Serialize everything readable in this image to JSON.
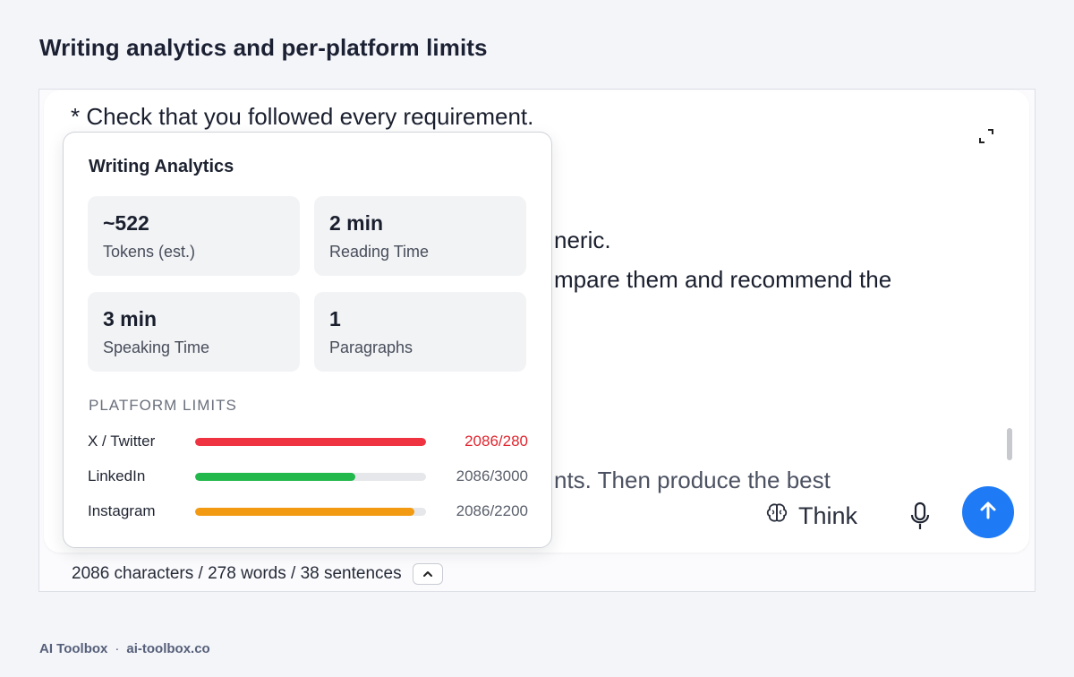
{
  "page": {
    "title": "Writing analytics and per-platform limits"
  },
  "editor": {
    "lines": [
      "* Check that you followed every requirement.",
      "neric.",
      "mpare them and recommend the",
      "nts. Then produce the best"
    ],
    "think_label": "Think"
  },
  "analytics": {
    "title": "Writing Analytics",
    "stats": [
      {
        "value": "~522",
        "label": "Tokens (est.)"
      },
      {
        "value": "2 min",
        "label": "Reading Time"
      },
      {
        "value": "3 min",
        "label": "Speaking Time"
      },
      {
        "value": "1",
        "label": "Paragraphs"
      }
    ],
    "limits_heading": "PLATFORM LIMITS",
    "platforms": [
      {
        "name": "X / Twitter",
        "count": "2086/280",
        "fill_fraction": 1.0,
        "color": "#ef3340",
        "count_color": "#e0262f"
      },
      {
        "name": "LinkedIn",
        "count": "2086/3000",
        "fill_fraction": 0.695,
        "color": "#22b84c",
        "count_color": "#5a5f6b"
      },
      {
        "name": "Instagram",
        "count": "2086/2200",
        "fill_fraction": 0.948,
        "color": "#f29a12",
        "count_color": "#5a5f6b"
      }
    ]
  },
  "footer": {
    "stats": "2086 characters / 278 words / 38 sentences"
  },
  "brand": {
    "name": "AI Toolbox",
    "separator": "·",
    "domain": "ai-toolbox.co"
  },
  "colors": {
    "accent": "#1f7bf5"
  }
}
